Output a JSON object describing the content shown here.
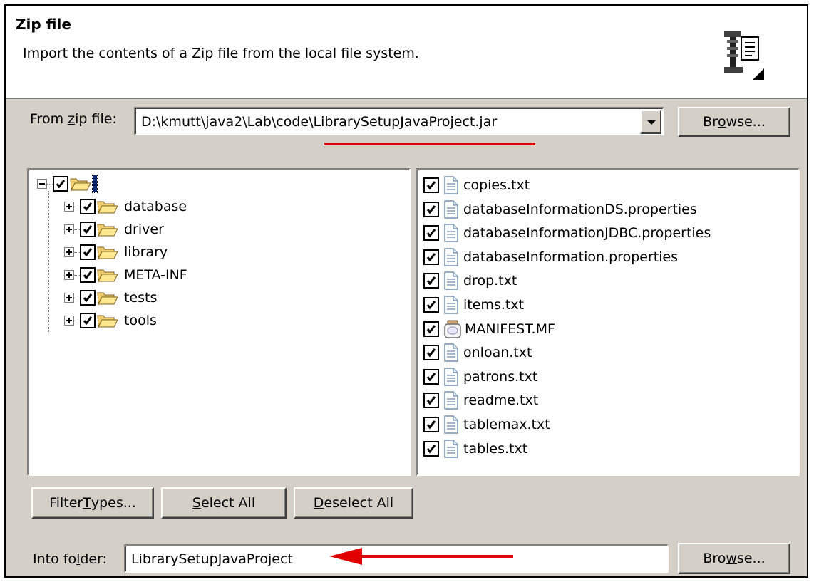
{
  "banner": {
    "title": "Zip file",
    "description": "Import the contents of a Zip file from the local file system.",
    "icon": "zip-import-wizard-icon"
  },
  "from_zip": {
    "label_pre": "From ",
    "label_mnemonic": "z",
    "label_post": "ip file:",
    "value_prefix": "D:\\kmutt\\java2\\Lab\\code\\",
    "value_highlight": "LibrarySetupJavaProject.jar",
    "browse_pre": "Br",
    "browse_mnemonic": "o",
    "browse_post": "wse..."
  },
  "tree": {
    "root_label": "/",
    "folders": [
      {
        "label": "database"
      },
      {
        "label": "driver"
      },
      {
        "label": "library"
      },
      {
        "label": "META-INF"
      },
      {
        "label": "tests"
      },
      {
        "label": "tools"
      }
    ]
  },
  "files": [
    {
      "label": "copies.txt",
      "icon": "text-file-icon"
    },
    {
      "label": "databaseInformationDS.properties",
      "icon": "text-file-icon"
    },
    {
      "label": "databaseInformationJDBC.properties",
      "icon": "text-file-icon"
    },
    {
      "label": "databaseInformation.properties",
      "icon": "text-file-icon"
    },
    {
      "label": "drop.txt",
      "icon": "text-file-icon"
    },
    {
      "label": "items.txt",
      "icon": "text-file-icon"
    },
    {
      "label": "MANIFEST.MF",
      "icon": "jar-manifest-icon"
    },
    {
      "label": "onloan.txt",
      "icon": "text-file-icon"
    },
    {
      "label": "patrons.txt",
      "icon": "text-file-icon"
    },
    {
      "label": "readme.txt",
      "icon": "text-file-icon"
    },
    {
      "label": "tablemax.txt",
      "icon": "text-file-icon"
    },
    {
      "label": "tables.txt",
      "icon": "text-file-icon"
    }
  ],
  "buttons": {
    "filter_pre": "Filter ",
    "filter_mnemonic": "T",
    "filter_post": "ypes...",
    "select_mnemonic": "S",
    "select_post": "elect All",
    "deselect_mnemonic": "D",
    "deselect_post": "eselect All"
  },
  "into_folder": {
    "label_pre": "Into fo",
    "label_mnemonic": "l",
    "label_post": "der:",
    "value": "LibrarySetupJavaProject",
    "browse_pre": "Bro",
    "browse_mnemonic": "w",
    "browse_post": "se..."
  },
  "colors": {
    "annotation_red": "#e00000",
    "dialog_face": "#d4d0c8"
  }
}
